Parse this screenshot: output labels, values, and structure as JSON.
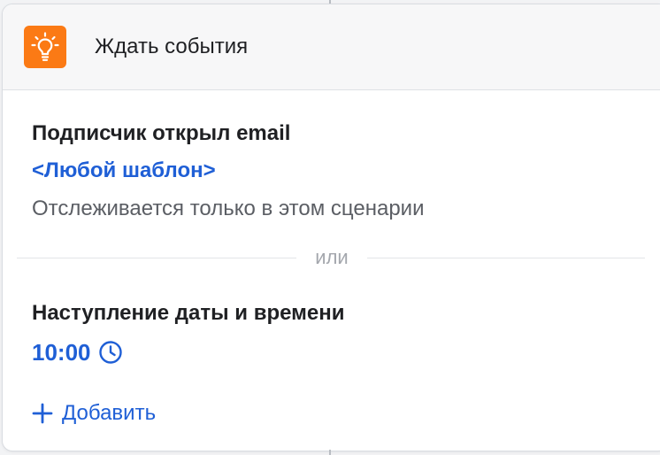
{
  "header": {
    "title": "Ждать события",
    "icon": "lightbulb-icon",
    "icon_bg": "#fb7a15"
  },
  "conditions": [
    {
      "title": "Подписчик открыл email",
      "link": "<Любой шаблон>",
      "description": "Отслеживается только в этом сценарии"
    },
    {
      "title": "Наступление даты и времени",
      "time": "10:00",
      "time_icon": "clock-icon"
    }
  ],
  "divider": {
    "label": "или"
  },
  "add_action": {
    "label": "Добавить",
    "icon": "plus-icon"
  },
  "colors": {
    "accent": "#1f5fd6",
    "text": "#1f2023",
    "muted": "#5b5e64"
  }
}
